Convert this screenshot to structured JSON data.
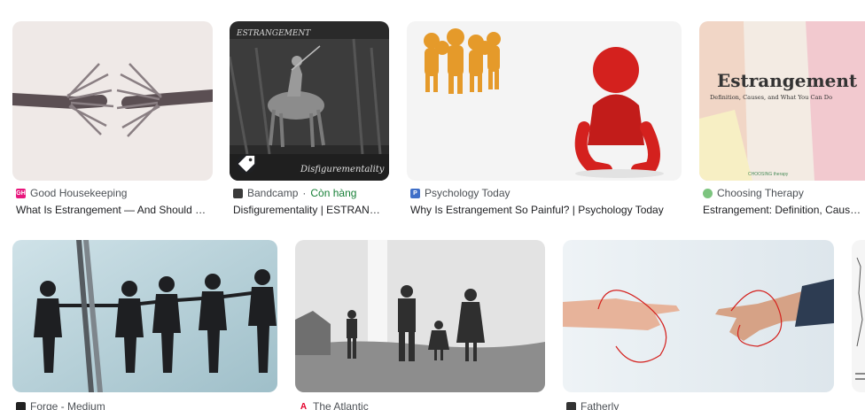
{
  "results": [
    {
      "source": "Good Housekeeping",
      "title": "What Is Estrangement — And Should …",
      "favicon": "GH",
      "favicon_color": "#e8177d"
    },
    {
      "source": "Bandcamp",
      "separator": " · ",
      "stock": "Còn hàng",
      "title": "Disfigurementality | ESTRAN…",
      "favicon": "",
      "favicon_color": "#3a3a3a",
      "image_text": {
        "heading": "ESTRANGEMENT",
        "caption": "Disfigurementality"
      }
    },
    {
      "source": "Psychology Today",
      "title": "Why Is Estrangement So Painful? | Psychology Today",
      "favicon": "P",
      "favicon_color": "#3f6fc8"
    },
    {
      "source": "Choosing Therapy",
      "title": "Estrangement: Definition, Caus…",
      "favicon": "",
      "favicon_color": "#7cc47f",
      "image_text": {
        "heading": "Estrangement",
        "subheading": "Definition, Causes, and What You Can Do",
        "logo": "CHOOSING therapy"
      }
    },
    {
      "source": "Forge - Medium",
      "title": "",
      "favicon": "",
      "favicon_color": "#222222"
    },
    {
      "source": "The Atlantic",
      "title": "",
      "favicon": "A",
      "favicon_color": "#e4002b"
    },
    {
      "source": "Fatherly",
      "title": "",
      "favicon": "",
      "favicon_color": "#333333"
    }
  ],
  "colors": {
    "accent_red": "#d4211e",
    "stock_green": "#188038"
  }
}
